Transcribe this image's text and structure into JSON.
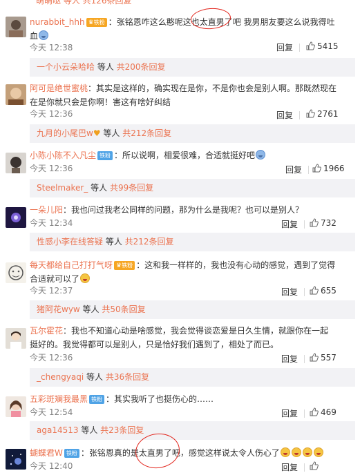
{
  "top_fragment": "萌萌哒 等人 共126条回复",
  "comments": [
    {
      "user": "nurabbit_hhh",
      "badge": "铁粉",
      "badge_icon": "crown-icon",
      "content_line1": "张铭恩咋这么憨呢这也太直男了吧 我男朋友要这么说我得吐",
      "content_line2": "血",
      "emoji": "dizzy-emoji",
      "time": "今天 12:38",
      "reply_label": "回复",
      "likes": "5415",
      "sub": {
        "name": "一个小云朵哈哈",
        "mid": " 等人 ",
        "count": "共200条回复"
      }
    },
    {
      "user": "阿可是绝世蜜桃",
      "content_line1": "其实是这样的，确实现在是你，不是你也会是别人啊。那既然现在",
      "content_line2": "在是你就只会是你啊！害这有啥好纠结",
      "time": "今天 12:36",
      "reply_label": "回复",
      "likes": "2761",
      "sub": {
        "name": "九月的小尾巴w",
        "mid": " 等人 ",
        "count": "共212条回复"
      }
    },
    {
      "user": "小陈小陈不入凡尘",
      "badge": "铁粉",
      "content_line1": "所以说啊，相爱很难，合适就挺好吧",
      "time": "今天 12:36",
      "reply_label": "回复",
      "likes": "1966",
      "sub": {
        "name": "Steelmaker_",
        "mid": " 等人 ",
        "count": "共99条回复"
      }
    },
    {
      "user": "一朵儿阳",
      "content_line1": "我也问过我老公同样的问题，那为什么是我呢？也可以是别人？",
      "time": "今天 12:34",
      "reply_label": "回复",
      "likes": "732",
      "sub": {
        "name": "性感小李在线答疑",
        "mid": " 等人 ",
        "count": "共212条回复"
      }
    },
    {
      "user": "每天都给自己打打气呀",
      "badge": "铁粉",
      "content_line1": "这和我一样样的，我也没有心动的感觉，遇到了觉得",
      "content_line2": "合适就可以了",
      "time": "今天 12:37",
      "reply_label": "回复",
      "likes": "655",
      "sub": {
        "name": "猪阿花wyw",
        "mid": " 等人 ",
        "count": "共50条回复"
      }
    },
    {
      "user": "瓦尔霍花",
      "content_line1": "我也不知道心动是啥感觉，我会觉得谈恋爱是日久生情，就跟你在一起",
      "content_line2": "挺好的。我觉得都可以是别人，只是恰好我们遇到了，相处了而已。",
      "time": "今天 12:36",
      "reply_label": "回复",
      "likes": "557",
      "sub": {
        "name": "_chengyaqi",
        "mid": " 等人 ",
        "count": "共36条回复"
      }
    },
    {
      "user": "五彩斑斓我最黑",
      "badge": "铁粉",
      "content_line1": "其实我听了也挺伤心的……",
      "time": "今天 12:54",
      "reply_label": "回复",
      "likes": "469",
      "sub": {
        "name": "aga14513",
        "mid": " 等人 ",
        "count": "共23条回复"
      }
    },
    {
      "user": "蝴蝶君W",
      "badge": "铁粉",
      "content_line1": "张铭恩真的是太直男了吧，感觉这样说太令人伤心了",
      "time": "今天 12:40",
      "reply_label": "回复"
    }
  ],
  "colors": {
    "username": "#eb7350",
    "annotation_circle": "#e2231a",
    "sub_bg": "#f2f2f5"
  }
}
